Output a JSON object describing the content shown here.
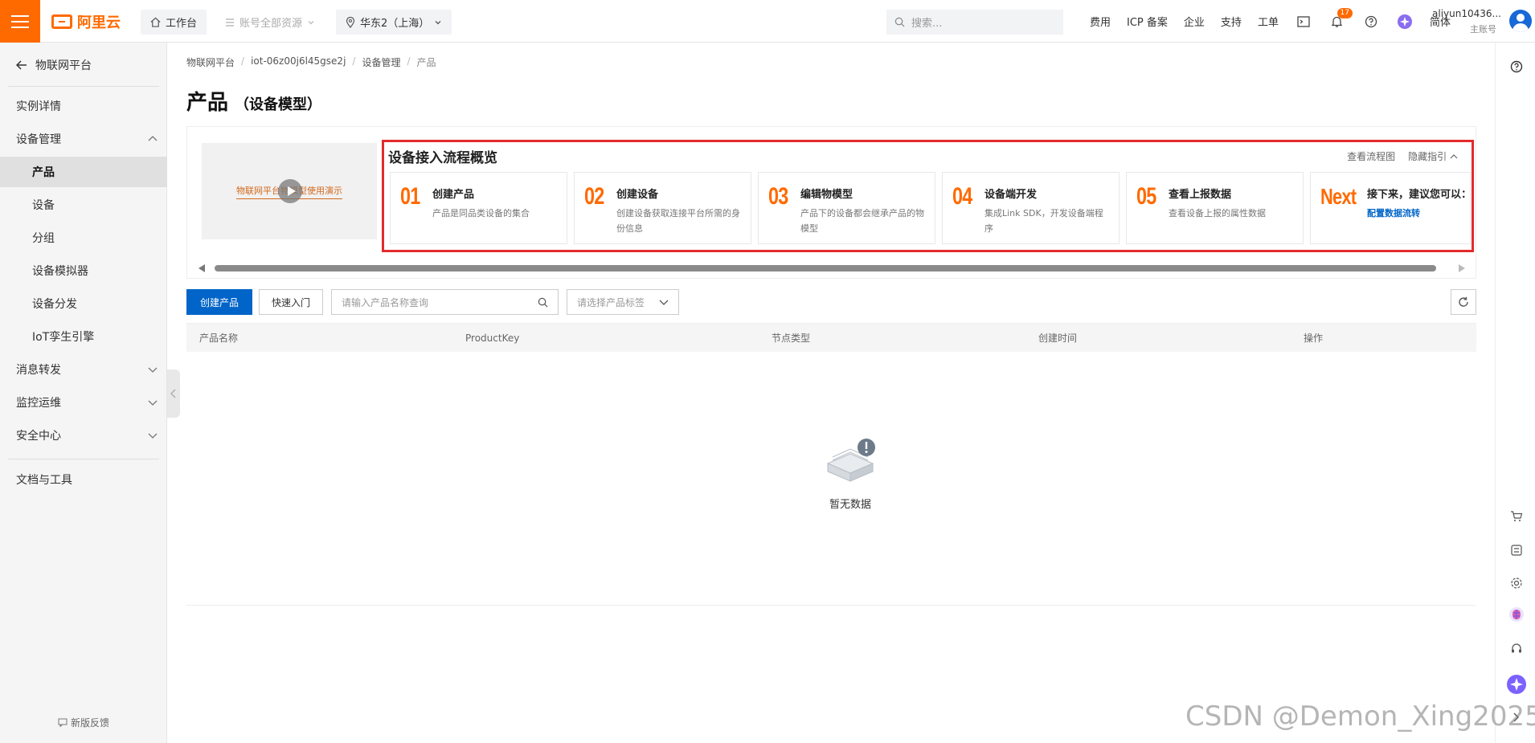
{
  "topbar": {
    "brand": "阿里云",
    "workbench": "工作台",
    "account_resources": "账号全部资源",
    "region": "华东2（上海）",
    "search_placeholder": "搜索...",
    "links": [
      "费用",
      "ICP 备案",
      "企业",
      "支持",
      "工单"
    ],
    "notification_count": "17",
    "lang": "简体",
    "user_name": "aliyun10436...",
    "user_role": "主账号"
  },
  "sidebar": {
    "back": "物联网平台",
    "items": [
      {
        "label": "实例详情"
      },
      {
        "label": "设备管理"
      },
      {
        "label": "产品"
      },
      {
        "label": "设备"
      },
      {
        "label": "分组"
      },
      {
        "label": "设备模拟器"
      },
      {
        "label": "设备分发"
      },
      {
        "label": "IoT孪生引擎"
      },
      {
        "label": "消息转发"
      },
      {
        "label": "监控运维"
      },
      {
        "label": "安全中心"
      },
      {
        "label": "文档与工具"
      }
    ],
    "feedback": "新版反馈"
  },
  "breadcrumb": [
    "物联网平台",
    "iot-06z00j6l45gse2j",
    "设备管理",
    "产品"
  ],
  "page": {
    "title": "产品",
    "subtitle": "（设备模型）"
  },
  "guide": {
    "video_text": "物联网平台物模型使用演示",
    "title": "设备接入流程概览",
    "view_flow": "查看流程图",
    "hide_guide": "隐藏指引",
    "steps": [
      {
        "num": "01",
        "title": "创建产品",
        "desc": "产品是同品类设备的集合"
      },
      {
        "num": "02",
        "title": "创建设备",
        "desc": "创建设备获取连接平台所需的身份信息"
      },
      {
        "num": "03",
        "title": "编辑物模型",
        "desc": "产品下的设备都会继承产品的物模型"
      },
      {
        "num": "04",
        "title": "设备端开发",
        "desc": "集成Link SDK，开发设备端程序"
      },
      {
        "num": "05",
        "title": "查看上报数据",
        "desc": "查看设备上报的属性数据"
      },
      {
        "num": "Next",
        "title": "接下来，建议您可以：",
        "desc": "配置数据流转"
      }
    ]
  },
  "toolbar": {
    "create_product": "创建产品",
    "quick_start": "快速入门",
    "search_placeholder": "请输入产品名称查询",
    "tag_select": "请选择产品标签"
  },
  "table": {
    "columns": [
      "产品名称",
      "ProductKey",
      "节点类型",
      "创建时间",
      "操作"
    ],
    "empty_text": "暂无数据"
  },
  "watermark": "CSDN @Demon_Xing2025"
}
